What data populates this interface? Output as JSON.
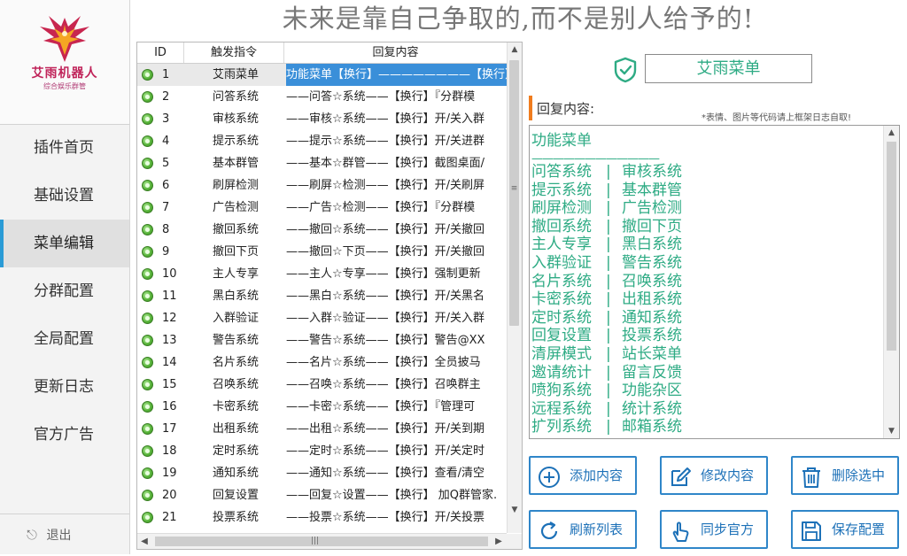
{
  "header": {
    "slogan": "未来是靠自己争取的,而不是别人给予的!"
  },
  "logo": {
    "title": "艾雨机器人",
    "subtitle": "综合娱乐群管"
  },
  "sidebar": {
    "items": [
      {
        "label": "插件首页"
      },
      {
        "label": "基础设置"
      },
      {
        "label": "菜单编辑",
        "active": true
      },
      {
        "label": "分群配置"
      },
      {
        "label": "全局配置"
      },
      {
        "label": "更新日志"
      },
      {
        "label": "官方广告"
      }
    ],
    "logout": "退出"
  },
  "table": {
    "headers": [
      "ID",
      "触发指令",
      "回复内容"
    ],
    "rows": [
      {
        "id": "1",
        "trigger": "艾雨菜单",
        "reply": "功能菜单【换行】————————【换行】",
        "selected": true
      },
      {
        "id": "2",
        "trigger": "问答系统",
        "reply": "——问答☆系统——【换行】『分群模"
      },
      {
        "id": "3",
        "trigger": "审核系统",
        "reply": "——审核☆系统——【换行】开/关入群"
      },
      {
        "id": "4",
        "trigger": "提示系统",
        "reply": "——提示☆系统——【换行】开/关进群"
      },
      {
        "id": "5",
        "trigger": "基本群管",
        "reply": "——基本☆群管——【换行】截图桌面/"
      },
      {
        "id": "6",
        "trigger": "刷屏检测",
        "reply": "——刷屏☆检测——【换行】开/关刷屏"
      },
      {
        "id": "7",
        "trigger": "广告检测",
        "reply": "——广告☆检测——【换行】『分群模"
      },
      {
        "id": "8",
        "trigger": "撤回系统",
        "reply": "——撤回☆系统——【换行】开/关撤回"
      },
      {
        "id": "9",
        "trigger": "撤回下页",
        "reply": "——撤回☆下页——【换行】开/关撤回"
      },
      {
        "id": "10",
        "trigger": "主人专享",
        "reply": "——主人☆专享——【换行】强制更新"
      },
      {
        "id": "11",
        "trigger": "黑白系统",
        "reply": "——黑白☆系统——【换行】开/关黑名"
      },
      {
        "id": "12",
        "trigger": "入群验证",
        "reply": "——入群☆验证——【换行】开/关入群"
      },
      {
        "id": "13",
        "trigger": "警告系统",
        "reply": "——警告☆系统——【换行】警告@XX"
      },
      {
        "id": "14",
        "trigger": "名片系统",
        "reply": "——名片☆系统——【换行】全员披马"
      },
      {
        "id": "15",
        "trigger": "召唤系统",
        "reply": "——召唤☆系统——【换行】召唤群主"
      },
      {
        "id": "16",
        "trigger": "卡密系统",
        "reply": "——卡密☆系统——【换行】『管理可"
      },
      {
        "id": "17",
        "trigger": "出租系统",
        "reply": "——出租☆系统——【换行】开/关到期"
      },
      {
        "id": "18",
        "trigger": "定时系统",
        "reply": "——定时☆系统——【换行】开/关定时"
      },
      {
        "id": "19",
        "trigger": "通知系统",
        "reply": "——通知☆系统——【换行】查看/清空"
      },
      {
        "id": "20",
        "trigger": "回复设置",
        "reply": "——回复☆设置——【换行】 加Q群管家."
      },
      {
        "id": "21",
        "trigger": "投票系统",
        "reply": "——投票☆系统——【换行】开/关投票"
      }
    ]
  },
  "editor": {
    "trigger_value": "艾雨菜单",
    "reply_label": "回复内容:",
    "reply_note": "*表情、图片等代码请上框架日志自取!",
    "reply_title": "功能菜单",
    "reply_line": "————————————",
    "menu_left": [
      "问答系统",
      "提示系统",
      "刷屏检测",
      "撤回系统",
      "主人专享",
      "入群验证",
      "名片系统",
      "卡密系统",
      "定时系统",
      "回复设置",
      "清屏模式",
      "邀请统计",
      "喷狗系统",
      "远程系统",
      "扩列系统"
    ],
    "menu_right": [
      "审核系统",
      "基本群管",
      "广告检测",
      "撤回下页",
      "黑白系统",
      "警告系统",
      "召唤系统",
      "出租系统",
      "通知系统",
      "投票系统",
      "站长菜单",
      "留言反馈",
      "功能杂区",
      "统计系统",
      "邮箱系统"
    ]
  },
  "buttons": {
    "add": "添加内容",
    "edit": "修改内容",
    "delete": "删除选中",
    "refresh": "刷新列表",
    "sync": "同步官方",
    "save": "保存配置"
  },
  "colors": {
    "accent": "#2f86c9",
    "menu_text": "#2eab84",
    "label_bar": "#f07c1e",
    "selection": "#3a8fd9"
  },
  "icons": {
    "shield": "shield-check-icon",
    "add": "plus-circle-icon",
    "edit": "edit-icon",
    "delete": "trash-icon",
    "refresh": "refresh-icon",
    "sync": "hand-pointer-icon",
    "save": "floppy-disk-icon"
  }
}
